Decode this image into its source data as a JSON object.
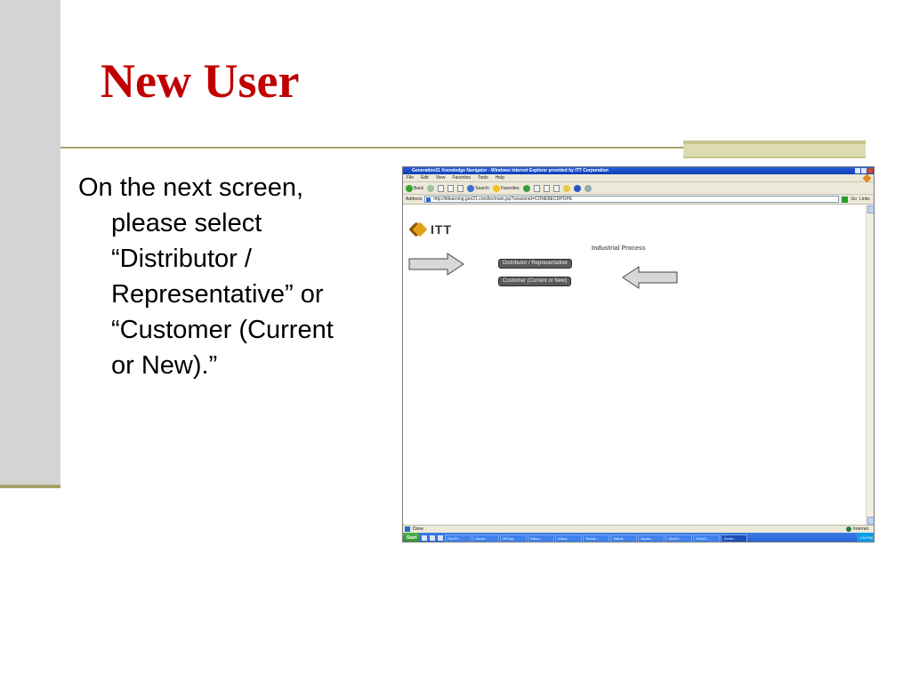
{
  "slide": {
    "title": "New User",
    "body_line1": "On the next screen,",
    "body_lines": [
      "please select",
      "“Distributor /",
      "Representative” or",
      "“Customer (Current",
      "or New).”"
    ]
  },
  "browser": {
    "window_title": "Generation21 Knowledge Navigator - Windows Internet Explorer provided by ITT Corporation",
    "menu": [
      "File",
      "Edit",
      "View",
      "Favorites",
      "Tools",
      "Help"
    ],
    "toolbar": {
      "back_label": "Back",
      "search_label": "Search",
      "favorites_label": "Favorites"
    },
    "address": {
      "label": "Address",
      "url": "http://ittlearning.gen21.com/kn/main.jsp?sessionid=CONEBECDPOPE",
      "go_label": "Go",
      "links_label": "Links"
    },
    "page": {
      "logo_text": "ITT",
      "section_label": "Industrial Process",
      "option_distributor": "Distributor / Representative",
      "option_customer": "Customer (Current or New)"
    },
    "status": {
      "text": "Done",
      "zone": "Internet"
    },
    "taskbar": {
      "start_label": "Start",
      "tasks": [
        {
          "label": "Pre-Pr..."
        },
        {
          "label": "Home ..."
        },
        {
          "label": "HR Ap..."
        },
        {
          "label": "Micro..."
        },
        {
          "label": "Micro..."
        },
        {
          "label": "Knowl..."
        },
        {
          "label": "Talent..."
        },
        {
          "label": "Acces..."
        },
        {
          "label": "Gen21..."
        },
        {
          "label": "Gen21..."
        },
        {
          "label": "Gener..."
        }
      ],
      "clock": "1:34 PM"
    }
  },
  "colors": {
    "title_red": "#c00000",
    "accent_olive": "#a5a26a",
    "side_gray": "#d4d4d4"
  }
}
